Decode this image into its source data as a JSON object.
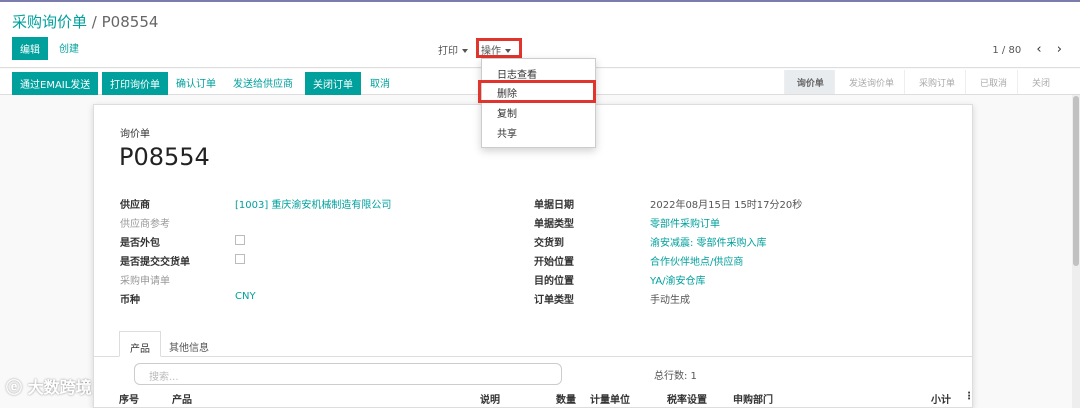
{
  "breadcrumb": {
    "parent": "采购询价单",
    "sep": "/",
    "current": "P08554"
  },
  "buttons": {
    "edit": "编辑",
    "create": "创建"
  },
  "topmenu": {
    "print": "打印",
    "action": "操作"
  },
  "pager": {
    "value": "1 / 80",
    "prev": "‹",
    "next": "›"
  },
  "action_menu": [
    "日志查看",
    "删除",
    "复制",
    "共享"
  ],
  "toolbar": {
    "email": "通过EMAIL发送",
    "print_rfq": "打印询价单",
    "confirm": "确认订单",
    "send_vendor": "发送给供应商",
    "close": "关闭订单",
    "cancel": "取消"
  },
  "status_steps": [
    "询价单",
    "发送询价单",
    "采购订单",
    "已取消",
    "关闭"
  ],
  "form": {
    "doc_type": "询价单",
    "name": "P08554",
    "left": [
      {
        "label": "供应商",
        "value": "[1003] 重庆渝安机械制造有限公司",
        "kind": "link"
      },
      {
        "label": "供应商参考",
        "value": "",
        "kind": "muted"
      },
      {
        "label": "是否外包",
        "value": "",
        "kind": "checkbox"
      },
      {
        "label": "是否提交交货单",
        "value": "",
        "kind": "checkbox"
      },
      {
        "label": "采购申请单",
        "value": "",
        "kind": "muted"
      },
      {
        "label": "币种",
        "value": "CNY",
        "kind": "link"
      }
    ],
    "right": [
      {
        "label": "单据日期",
        "value": "2022年08月15日 15时17分20秒",
        "kind": "text"
      },
      {
        "label": "单据类型",
        "value": "零部件采购订单",
        "kind": "link"
      },
      {
        "label": "交货到",
        "value": "渝安减震: 零部件采购入库",
        "kind": "link"
      },
      {
        "label": "开始位置",
        "value": "合作伙伴地点/供应商",
        "kind": "link"
      },
      {
        "label": "目的位置",
        "value": "YA/渝安仓库",
        "kind": "link"
      },
      {
        "label": "订单类型",
        "value": "手动生成",
        "kind": "text"
      }
    ]
  },
  "tabs": [
    "产品",
    "其他信息"
  ],
  "lines": {
    "search_placeholder": "搜索...",
    "total": "总行数: 1",
    "columns": [
      "序号",
      "产品",
      "说明",
      "数量",
      "计量单位",
      "税率设置",
      "申购部门",
      "小计"
    ]
  },
  "watermark": "大数跨境"
}
